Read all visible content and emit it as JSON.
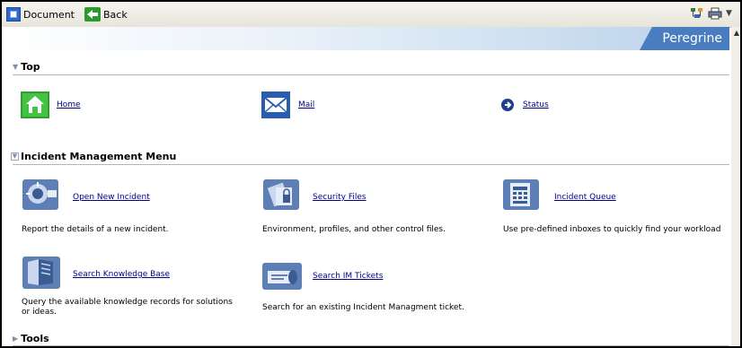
{
  "toolbar": {
    "document_label": "Document",
    "back_label": "Back"
  },
  "banner": {
    "brand": "Peregrine"
  },
  "sections": {
    "top": "Top",
    "incident": "Incident Management Menu",
    "tools": "Tools"
  },
  "top_items": {
    "home": "Home",
    "mail": "Mail",
    "status": "Status"
  },
  "incident_items": {
    "open_new": {
      "label": "Open New Incident",
      "desc": "Report the details of  a new incident."
    },
    "security": {
      "label": "Security Files",
      "desc": "Environment, profiles, and other control files."
    },
    "queue": {
      "label": "Incident Queue",
      "desc": "Use pre-defined inboxes to quickly find your workload"
    },
    "kb": {
      "label": "Search Knowledge Base",
      "desc": "Query the available knowledge records for solutions or ideas."
    },
    "im": {
      "label": "Search IM Tickets",
      "desc": "Search for an existing Incident Managment ticket."
    }
  },
  "colors": {
    "brand_blue": "#4a7cc0",
    "link": "#00008b"
  }
}
